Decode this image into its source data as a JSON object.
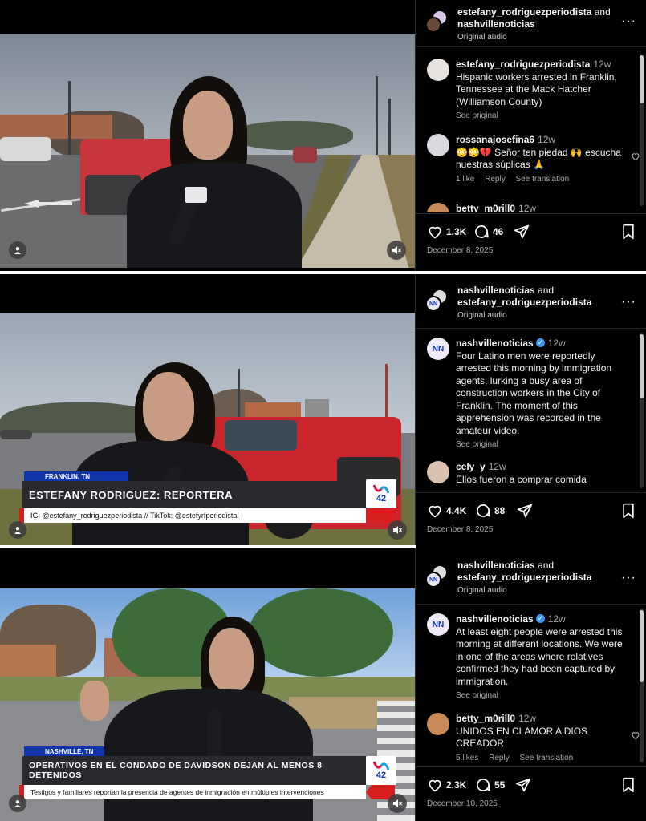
{
  "posts": [
    {
      "authors": {
        "first": "estefany_rodriguezperiodista",
        "joiner": "and",
        "second": "nashvillenoticias"
      },
      "audio": "Original audio",
      "caption": {
        "user": "estefany_rodriguezperiodista",
        "time": "12w",
        "text": "Hispanic workers arrested in Franklin, Tennessee at the Mack Hatcher (Williamson County)",
        "see_original": "See original"
      },
      "comments": [
        {
          "user": "rossanajosefina6",
          "time": "12w",
          "text": "😳😳💔 Señor ten piedad 🙌 escucha nuestras súplicas 🙏",
          "likes": "1 like",
          "reply": "Reply",
          "translate": "See translation"
        },
        {
          "user": "betty_m0rill0",
          "time": "12w",
          "text": ""
        }
      ],
      "likes": "1.3K",
      "comment_count": "46",
      "date": "December 8, 2025"
    },
    {
      "authors": {
        "first": "nashvillenoticias",
        "joiner": "and",
        "second": "estefany_rodriguezperiodista"
      },
      "audio": "Original audio",
      "caption": {
        "user": "nashvillenoticias",
        "time": "12w",
        "text": "Four Latino men were reportedly arrested this morning by immigration agents, lurking a busy area of construction workers in the City of Franklin. The moment of this apprehension was recorded in the amateur video.",
        "see_original": "See original"
      },
      "comments": [
        {
          "user": "cely_y",
          "time": "12w",
          "text": "Ellos fueron a comprar comida"
        }
      ],
      "lower_third": {
        "city": "FRANKLIN, TN",
        "headline": "ESTEFANY RODRIGUEZ: REPORTERA",
        "sub": "IG: @estefany_rodriguezperiodista // TikTok: @estefyrfperiodistal",
        "channel": "42"
      },
      "likes": "4.4K",
      "comment_count": "88",
      "date": "December 8, 2025"
    },
    {
      "authors": {
        "first": "nashvillenoticias",
        "joiner": "and",
        "second": "estefany_rodriguezperiodista"
      },
      "audio": "Original audio",
      "caption": {
        "user": "nashvillenoticias",
        "time": "12w",
        "text": "At least eight people were arrested this morning at different locations. We were in one of the areas where relatives confirmed they had been captured by immigration.",
        "see_original": "See original"
      },
      "comments": [
        {
          "user": "betty_m0rill0",
          "time": "12w",
          "text": "UNIDOS EN CLAMOR A DIOS CREADOR",
          "likes": "5 likes",
          "reply": "Reply",
          "translate": "See translation"
        }
      ],
      "lower_third": {
        "city": "NASHVILLE, TN",
        "headline": "OPERATIVOS EN EL CONDADO DE DAVIDSON DEJAN AL MENOS 8 DETENIDOS",
        "sub": "Testigos y familiares reportan la presencia de agentes de inmigración en múltiples intervenciones",
        "channel": "42"
      },
      "likes": "2.3K",
      "comment_count": "55",
      "date": "December 10, 2025"
    }
  ],
  "icons": {
    "like": "heart-icon",
    "comment": "comment-bubble-icon",
    "share": "paper-plane-icon",
    "save": "bookmark-icon",
    "more": "more-options-icon",
    "mute": "muted-speaker-icon",
    "profile": "user-icon"
  },
  "colors": {
    "background": "#000000",
    "text": "#f5f5f5",
    "muted": "#a8a8a8",
    "verified": "#3897f0",
    "lower_third_blue": "#1035a8",
    "lower_third_red": "#d81e1e"
  }
}
